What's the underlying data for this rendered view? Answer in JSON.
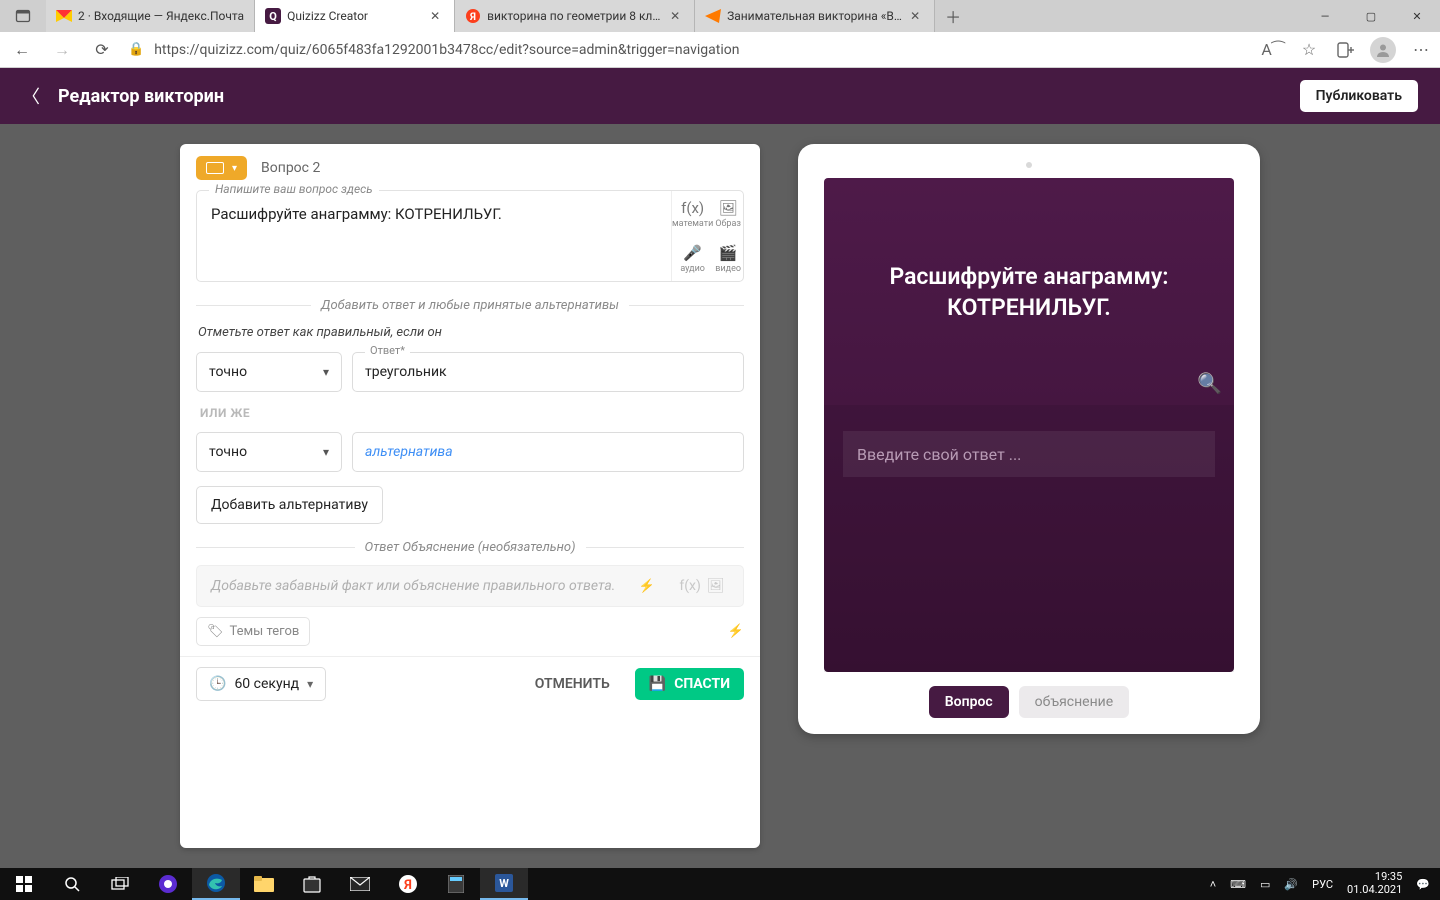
{
  "browser": {
    "tabs": [
      {
        "title": "2 · Входящие — Яндекс.Почта"
      },
      {
        "title": "Quizizz Creator"
      },
      {
        "title": "викторина по геометрии 8 клас"
      },
      {
        "title": "Занимательная викторина «Вес"
      }
    ],
    "url_display": "https://quizizz.com/quiz/6065f483fa1292001b3478cc/edit?source=admin&trigger=navigation"
  },
  "app": {
    "back_aria": "Назад",
    "title": "Редактор викторин",
    "publish": "Публиковать"
  },
  "editor": {
    "question_number": "Вопрос 2",
    "question_field_label": "Напишите ваш вопрос здесь",
    "question_text": "Расшифруйте анаграмму: КОТРЕНИЛЬУГ.",
    "media": {
      "math": "математи",
      "image": "Образ",
      "audio": "аудио",
      "video": "видео"
    },
    "answers_section": "Добавить ответ и любые принятые альтернативы",
    "hint": "Отметьте ответ как правильный, если он",
    "match_mode": "точно",
    "answer_label": "Ответ*",
    "answer_value": "треугольник",
    "or_label": "ИЛИ ЖЕ",
    "alt_match_mode": "точно",
    "alt_placeholder": "альтернатива",
    "add_alt": "Добавить альтернативу",
    "explain_section": "Ответ Объяснение (необязательно)",
    "explain_placeholder": "Добавьте забавный факт или объяснение правильного ответа.",
    "tags_placeholder": "Темы тегов",
    "time": "60 секунд",
    "cancel": "ОТМЕНИТЬ",
    "save": "СПАСТИ"
  },
  "preview": {
    "question": "Расшифруйте анаграмму: КОТРЕНИЛЬУГ.",
    "answer_placeholder": "Введите свой ответ ...",
    "tab_question": "Вопрос",
    "tab_explain": "объяснение"
  },
  "taskbar": {
    "lang": "РУС",
    "time": "19:35",
    "date": "01.04.2021"
  }
}
